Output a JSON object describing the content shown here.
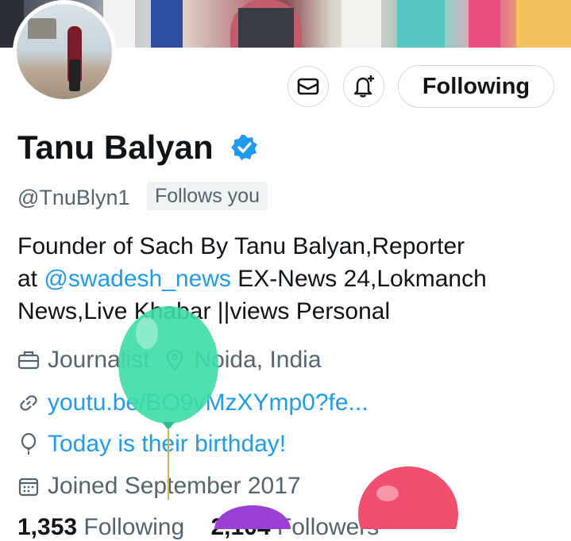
{
  "profile": {
    "name": "Tanu Balyan",
    "handle": "@TnuBlyn1",
    "follows_you": "Follows you",
    "bio_line1": "Founder of Sach By Tanu Balyan,Reporter",
    "bio_at": "at ",
    "bio_mention": "@swadesh_news",
    "bio_line2_rest": " EX-News 24,Lokmanch",
    "bio_line3": "News,Live Khabar ||views Personal",
    "category": "Journalist",
    "location": "Noida, India",
    "website": "youtu.be/BO9vMzXYmp0?fe...",
    "birthday": "Today is their birthday!",
    "joined": "Joined September 2017",
    "following_count": "1,353",
    "following_label": "Following",
    "followers_count": "2,104",
    "followers_label": "Followers"
  },
  "actions": {
    "message_icon": "envelope-icon",
    "notify_icon": "bell-plus-icon",
    "follow_label": "Following"
  },
  "colors": {
    "accent": "#1d9bf0",
    "muted": "#536471",
    "balloon_green": "#3ddba9",
    "balloon_pink": "#f0506e",
    "balloon_purple": "#9b3fd6"
  }
}
